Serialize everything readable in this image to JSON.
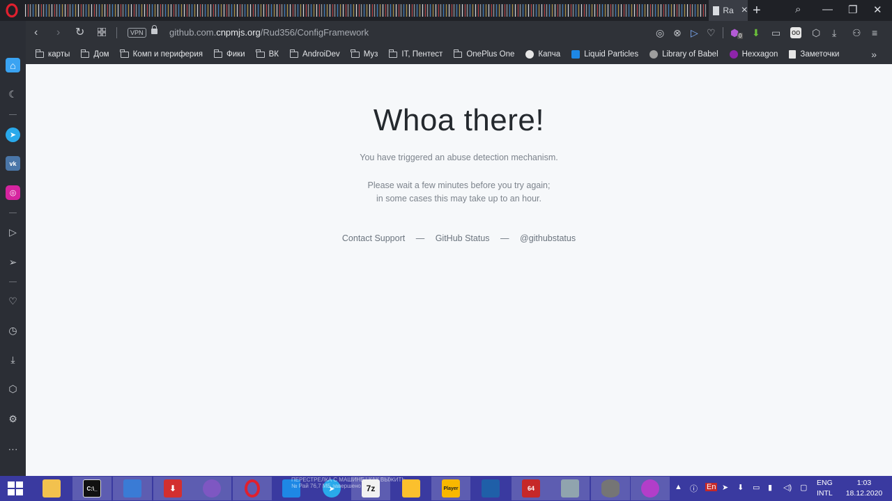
{
  "window": {
    "active_tab_title": "Ra",
    "new_tab_icon": "+",
    "controls": {
      "search": "⌕",
      "minimize": "—",
      "restore": "❐",
      "close": "✕"
    }
  },
  "address_bar": {
    "vpn_label": "VPN",
    "url_prefix": "github.com.",
    "url_domain": "cnpmjs.org",
    "url_path": "/Rud356/ConfigFramework",
    "extension_badge": "0"
  },
  "bookmarks": [
    {
      "label": "карты",
      "icon": "folder-icon"
    },
    {
      "label": "Дом",
      "icon": "folder-icon"
    },
    {
      "label": "Комп и периферия",
      "icon": "folder-icon"
    },
    {
      "label": "Фики",
      "icon": "folder-icon"
    },
    {
      "label": "ВК",
      "icon": "folder-icon"
    },
    {
      "label": "AndroiDev",
      "icon": "folder-icon"
    },
    {
      "label": "Муз",
      "icon": "folder-icon"
    },
    {
      "label": "IT, Пентест",
      "icon": "folder-icon"
    },
    {
      "label": "OnePlus One",
      "icon": "folder-icon"
    },
    {
      "label": "Капча",
      "icon": "captcha-icon",
      "color": "#e6e6e6"
    },
    {
      "label": "Liquid Particles",
      "icon": "wifi-icon",
      "color": "#1e88e5"
    },
    {
      "label": "Library of Babel",
      "icon": "hexagon-icon",
      "color": "#9e9e9e"
    },
    {
      "label": "Hexxagon",
      "icon": "hex-dot-icon",
      "color": "#8e24aa"
    },
    {
      "label": "Заметочки",
      "icon": "document-icon",
      "color": "#e6e6e6"
    }
  ],
  "page": {
    "headline": "Whoa there!",
    "message_1": "You have triggered an abuse detection mechanism.",
    "message_2_line1": "Please wait a few minutes before you try again;",
    "message_2_line2": "in some cases this may take up to an hour.",
    "links": {
      "contact_support": "Contact Support",
      "separator": "—",
      "github_status": "GitHub Status",
      "twitter": "@githubstatus"
    }
  },
  "taskbar": {
    "apps": [
      {
        "name": "file-explorer",
        "label": "",
        "color": "#f2c14e"
      },
      {
        "name": "command-prompt",
        "label": "C:\\_",
        "color": "#111111"
      },
      {
        "name": "remote-desktop",
        "label": "",
        "color": "#3a7bd5"
      },
      {
        "name": "downloader",
        "label": "⬇",
        "color": "#d32f2f"
      },
      {
        "name": "paint",
        "label": "",
        "color": "#7e57c2"
      },
      {
        "name": "opera",
        "label": "O",
        "color": "#e0202e"
      },
      {
        "name": "vs-code",
        "label": "",
        "color": "#1e88e5"
      },
      {
        "name": "telegram",
        "label": "",
        "color": "#29a9eb"
      },
      {
        "name": "7zip",
        "label": "7z",
        "color": "#f2f2f2"
      },
      {
        "name": "network-tool",
        "label": "",
        "color": "#fbc02d"
      },
      {
        "name": "player",
        "label": "Player",
        "color": "#f9b800"
      },
      {
        "name": "virtualbox",
        "label": "",
        "color": "#1f5fa8"
      },
      {
        "name": "debian-app",
        "label": "64",
        "color": "#c62828"
      },
      {
        "name": "monitor-app",
        "label": "",
        "color": "#90a4ae"
      },
      {
        "name": "database-app",
        "label": "",
        "color": "#757575"
      },
      {
        "name": "cat-app",
        "label": "",
        "color": "#b23ec9"
      }
    ],
    "ticker_line1": "ПЕРЕСТРЕЛКА С МАШИНЕ | КАК ВЫЖИТЬ",
    "ticker_line2": "№ Рай 76,7 МБ завершено",
    "lang_line1": "ENG",
    "lang_line2": "INTL",
    "time": "1:03",
    "date": "18.12.2020"
  }
}
